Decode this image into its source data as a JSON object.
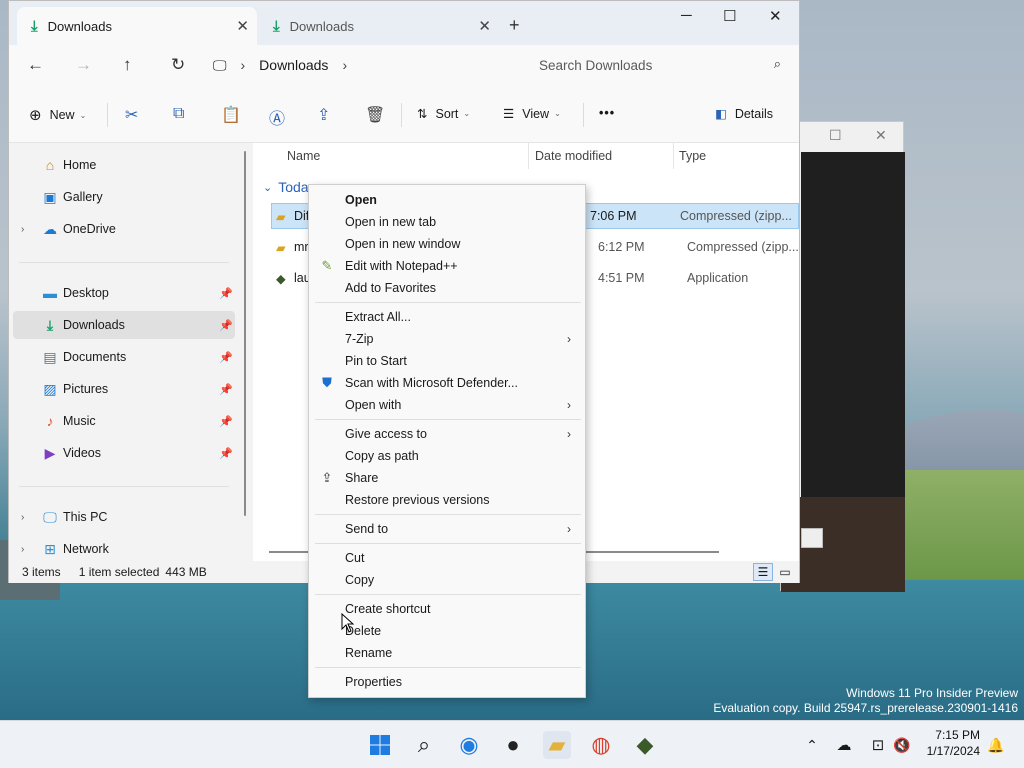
{
  "window": {
    "tabs": [
      {
        "label": "Downloads",
        "icon": "download-icon",
        "active": true
      },
      {
        "label": "Downloads",
        "icon": "download-icon",
        "active": false
      }
    ],
    "new_tab": "+",
    "controls": {
      "minimize": "─",
      "maximize": "☐",
      "close": "✕"
    }
  },
  "navbar": {
    "back": "←",
    "forward": "→",
    "up": "↑",
    "refresh": "↻",
    "breadcrumb": [
      "Downloads"
    ],
    "search_placeholder": "Search Downloads"
  },
  "toolbar": {
    "new_label": "New",
    "sort_label": "Sort",
    "view_label": "View",
    "more_label": "•••",
    "details_label": "Details"
  },
  "sidebar": {
    "top": [
      {
        "label": "Home",
        "icon": "home-icon"
      },
      {
        "label": "Gallery",
        "icon": "gallery-icon"
      },
      {
        "label": "OneDrive",
        "icon": "cloud-icon",
        "expandable": true
      }
    ],
    "pinned": [
      {
        "label": "Desktop",
        "icon": "desktop-icon"
      },
      {
        "label": "Downloads",
        "icon": "download-icon",
        "selected": true
      },
      {
        "label": "Documents",
        "icon": "documents-icon"
      },
      {
        "label": "Pictures",
        "icon": "pictures-icon"
      },
      {
        "label": "Music",
        "icon": "music-icon"
      },
      {
        "label": "Videos",
        "icon": "videos-icon"
      }
    ],
    "bottom": [
      {
        "label": "This PC",
        "icon": "pc-icon",
        "expandable": true
      },
      {
        "label": "Network",
        "icon": "network-icon",
        "expandable": true
      }
    ]
  },
  "columns": {
    "name": "Name",
    "date": "Date modified",
    "type": "Type"
  },
  "group": {
    "label": "Toda"
  },
  "files": [
    {
      "name": "Dif",
      "date": "7:06 PM",
      "type": "Compressed (zipp...",
      "icon": "zip-folder-icon",
      "selected": true
    },
    {
      "name": "mr",
      "date": "6:12 PM",
      "type": "Compressed (zipp...",
      "icon": "zip-folder-icon",
      "selected": false
    },
    {
      "name": "lau",
      "date": "4:51 PM",
      "type": "Application",
      "icon": "app-icon",
      "selected": false
    }
  ],
  "status": {
    "items": "3 items",
    "selected": "1 item selected",
    "size": "443 MB"
  },
  "context_menu": {
    "groups": [
      [
        {
          "label": "Open",
          "bold": true
        },
        {
          "label": "Open in new tab"
        },
        {
          "label": "Open in new window"
        },
        {
          "label": "Edit with Notepad++",
          "icon": "notepad-icon"
        },
        {
          "label": "Add to Favorites"
        }
      ],
      [
        {
          "label": "Extract All..."
        },
        {
          "label": "7-Zip",
          "submenu": true
        },
        {
          "label": "Pin to Start"
        },
        {
          "label": "Scan with Microsoft Defender...",
          "icon": "shield-icon"
        },
        {
          "label": "Open with",
          "submenu": true
        }
      ],
      [
        {
          "label": "Give access to",
          "submenu": true
        },
        {
          "label": "Copy as path"
        },
        {
          "label": "Share",
          "icon": "share-icon"
        },
        {
          "label": "Restore previous versions"
        }
      ],
      [
        {
          "label": "Send to",
          "submenu": true
        }
      ],
      [
        {
          "label": "Cut"
        },
        {
          "label": "Copy"
        }
      ],
      [
        {
          "label": "Create shortcut"
        },
        {
          "label": "Delete"
        },
        {
          "label": "Rename"
        }
      ],
      [
        {
          "label": "Properties"
        }
      ]
    ]
  },
  "watermark": {
    "line1": "Windows 11 Pro Insider Preview",
    "line2": "Evaluation copy. Build 25947.rs_prerelease.230901-1416"
  },
  "taskbar": {
    "apps": [
      "windows-start-icon",
      "search-icon",
      "edge-preview-icon",
      "obs-icon",
      "file-explorer-icon",
      "chrome-icon",
      "minecraft-icon"
    ],
    "time": "7:15 PM",
    "date": "1/17/2024"
  },
  "colors": {
    "accent": "#2b63b5",
    "download": "#17a06b",
    "selection": "#cce4f7"
  }
}
